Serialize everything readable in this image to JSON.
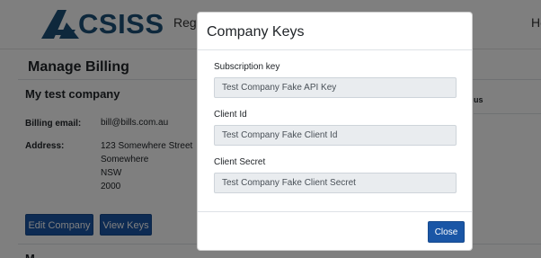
{
  "navbar": {
    "logo_text": "CSISS",
    "register_link": "Regis",
    "right_link": "He"
  },
  "page": {
    "title": "Manage Billing",
    "company_name": "My test company",
    "billing_email_label": "Billing email:",
    "billing_email_value": "bill@bills.com.au",
    "address_label": "Address:",
    "address_lines": [
      "123 Somewhere Street",
      "Somewhere",
      "NSW",
      "2000"
    ],
    "edit_company_label": "Edit Company",
    "view_keys_label": "View Keys",
    "bottom_section_title": "M                  ",
    "side_header": "us"
  },
  "modal": {
    "title": "Company Keys",
    "fields": [
      {
        "label": "Subscription key",
        "value": "Test Company Fake API Key"
      },
      {
        "label": "Client Id",
        "value": "Test Company Fake Client Id"
      },
      {
        "label": "Client Secret",
        "value": "Test Company Fake Client Secret"
      }
    ],
    "close_label": "Close"
  },
  "colors": {
    "primary": "#1a56a6",
    "logo": "#1c5078",
    "backdrop": "rgba(0,0,0,0.5)",
    "readonly_input": "#e9ecef"
  },
  "icons": {
    "logo": "acsiss-a-mark-icon"
  }
}
